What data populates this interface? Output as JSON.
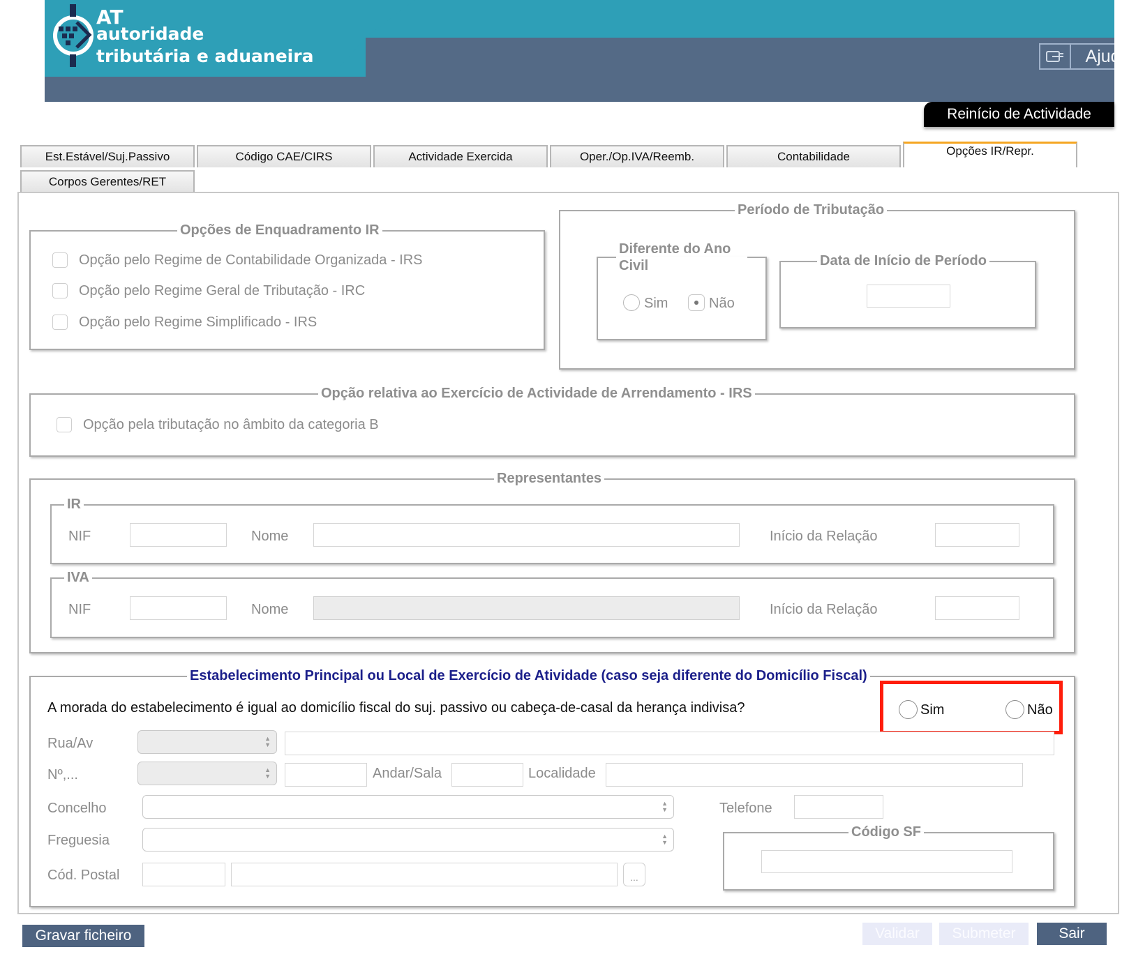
{
  "header": {
    "brand_at": "AT",
    "brand_line1": "autoridade",
    "brand_line2": "tributária e aduaneira",
    "help_label": "Ajuda",
    "section_title": "Reinício de Actividade"
  },
  "tabs": [
    {
      "label": "Est.Estável/Suj.Passivo"
    },
    {
      "label": "Código CAE/CIRS"
    },
    {
      "label": "Actividade Exercida"
    },
    {
      "label": "Oper./Op.IVA/Reemb."
    },
    {
      "label": "Contabilidade"
    },
    {
      "label": "Opções IR/Repr."
    },
    {
      "label": "Corpos Gerentes/RET"
    }
  ],
  "active_tab": "Opções IR/Repr.",
  "opcoes_enquadramento": {
    "legend": "Opções de Enquadramento IR",
    "options": [
      "Opção pelo Regime de Contabilidade Organizada - IRS",
      "Opção pelo Regime Geral de Tributação - IRC",
      "Opção pelo Regime Simplificado - IRS"
    ]
  },
  "periodo": {
    "legend": "Período de Tributação",
    "diferente_legend": "Diferente do Ano Civil",
    "sim": "Sim",
    "nao": "Não",
    "selected": "Não",
    "data_inicio_legend": "Data de Início de Período"
  },
  "arrendamento": {
    "legend": "Opção relativa ao Exercício de Actividade de Arrendamento - IRS",
    "option": "Opção pela tributação no âmbito da categoria B"
  },
  "representantes": {
    "legend": "Representantes",
    "ir": {
      "legend": "IR",
      "nif": "NIF",
      "nome": "Nome",
      "inicio": "Início da Relação"
    },
    "iva": {
      "legend": "IVA",
      "nif": "NIF",
      "nome": "Nome",
      "inicio": "Início da Relação"
    }
  },
  "estabelecimento": {
    "legend": "Estabelecimento Principal ou Local de Exercício de Atividade (caso seja diferente do Domicílio Fiscal)",
    "question": "A morada do estabelecimento é igual ao domicílio fiscal do suj. passivo ou cabeça-de-casal da herança indivisa?",
    "sim": "Sim",
    "nao": "Não",
    "rua": "Rua/Av",
    "numero": "Nº,...",
    "andar": "Andar/Sala",
    "localidade": "Localidade",
    "concelho": "Concelho",
    "telefone": "Telefone",
    "freguesia": "Freguesia",
    "cod_postal": "Cód. Postal",
    "codigo_sf_legend": "Código SF",
    "ellipsis": "..."
  },
  "buttons": {
    "gravar": "Gravar ficheiro",
    "validar": "Validar",
    "submeter": "Submeter",
    "sair": "Sair"
  },
  "colors": {
    "header_teal": "#2e9fb7",
    "header_slate": "#546a86",
    "legend_blue": "#1b1f8a",
    "highlight_red": "#ff1d0b",
    "button_blue": "#4e6380",
    "active_tab_accent": "#f5a623"
  }
}
